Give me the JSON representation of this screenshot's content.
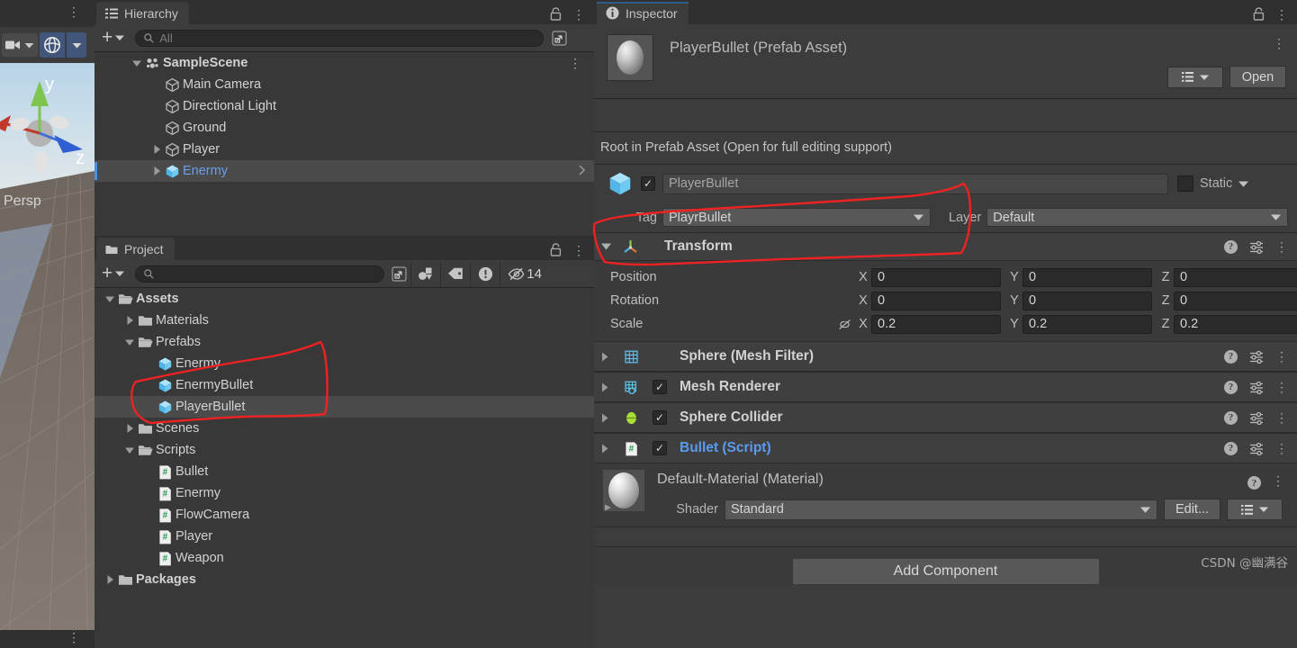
{
  "scene_view": {
    "camera_dropdown_icon": "camera-icon",
    "gizmo_icon": "scene-gizmo-icon",
    "axis_y": "y",
    "axis_z": "z",
    "projection_label": "Persp"
  },
  "hierarchy": {
    "tab_label": "Hierarchy",
    "tab_icon": "hierarchy-icon",
    "lock_icon": "lock-icon",
    "menu_icon": "kebab-menu-icon",
    "add_label": "+",
    "search_placeholder": "All",
    "search_icon": "search-icon",
    "expand_icon": "open-in-new-icon",
    "items": [
      {
        "label": "SampleScene",
        "icon": "scene-icon",
        "indent": 0,
        "arrow": "down",
        "bold": true,
        "selected": false,
        "blue": false,
        "menu": true
      },
      {
        "label": "Main Camera",
        "icon": "gameobject-icon",
        "indent": 1,
        "arrow": "none",
        "bold": false,
        "selected": false,
        "blue": false,
        "menu": false
      },
      {
        "label": "Directional Light",
        "icon": "gameobject-icon",
        "indent": 1,
        "arrow": "none",
        "bold": false,
        "selected": false,
        "blue": false,
        "menu": false
      },
      {
        "label": "Ground",
        "icon": "gameobject-icon",
        "indent": 1,
        "arrow": "none",
        "bold": false,
        "selected": false,
        "blue": false,
        "menu": false
      },
      {
        "label": "Player",
        "icon": "gameobject-icon",
        "indent": 1,
        "arrow": "right",
        "bold": false,
        "selected": false,
        "blue": false,
        "menu": false
      },
      {
        "label": "Enermy",
        "icon": "prefab-icon",
        "indent": 1,
        "arrow": "right",
        "bold": false,
        "selected": true,
        "blue": true,
        "menu": false
      }
    ]
  },
  "project": {
    "tab_label": "Project",
    "tab_icon": "folder-icon",
    "lock_icon": "lock-icon",
    "menu_icon": "kebab-menu-icon",
    "add_label": "+",
    "search_placeholder": "",
    "search_icon": "search-icon",
    "toolbar_icons": [
      "open-in-new-icon",
      "asset-filter-icon",
      "label-filter-icon",
      "warning-filter-icon"
    ],
    "hidden_count": "14",
    "hidden_icon": "eye-off-icon",
    "items": [
      {
        "label": "Assets",
        "icon": "folder-open-icon",
        "indent": 0,
        "arrow": "down",
        "bold": true,
        "selected": false
      },
      {
        "label": "Materials",
        "icon": "folder-icon",
        "indent": 1,
        "arrow": "right",
        "bold": false,
        "selected": false
      },
      {
        "label": "Prefabs",
        "icon": "folder-open-icon",
        "indent": 1,
        "arrow": "down",
        "bold": false,
        "selected": false
      },
      {
        "label": "Enermy",
        "icon": "prefab-icon",
        "indent": 2,
        "arrow": "none",
        "bold": false,
        "selected": false
      },
      {
        "label": "EnermyBullet",
        "icon": "prefab-icon",
        "indent": 2,
        "arrow": "none",
        "bold": false,
        "selected": false
      },
      {
        "label": "PlayerBullet",
        "icon": "prefab-icon",
        "indent": 2,
        "arrow": "none",
        "bold": false,
        "selected": true
      },
      {
        "label": "Scenes",
        "icon": "folder-icon",
        "indent": 1,
        "arrow": "right",
        "bold": false,
        "selected": false
      },
      {
        "label": "Scripts",
        "icon": "folder-open-icon",
        "indent": 1,
        "arrow": "down",
        "bold": false,
        "selected": false
      },
      {
        "label": "Bullet",
        "icon": "script-icon",
        "indent": 2,
        "arrow": "none",
        "bold": false,
        "selected": false
      },
      {
        "label": "Enermy",
        "icon": "script-icon",
        "indent": 2,
        "arrow": "none",
        "bold": false,
        "selected": false
      },
      {
        "label": "FlowCamera",
        "icon": "script-icon",
        "indent": 2,
        "arrow": "none",
        "bold": false,
        "selected": false
      },
      {
        "label": "Player",
        "icon": "script-icon",
        "indent": 2,
        "arrow": "none",
        "bold": false,
        "selected": false
      },
      {
        "label": "Weapon",
        "icon": "script-icon",
        "indent": 2,
        "arrow": "none",
        "bold": false,
        "selected": false
      },
      {
        "label": "Packages",
        "icon": "folder-icon",
        "indent": 0,
        "arrow": "right",
        "bold": true,
        "selected": false
      }
    ]
  },
  "inspector": {
    "tab_label": "Inspector",
    "tab_icon": "info-icon",
    "lock_icon": "lock-icon",
    "menu_icon": "kebab-menu-icon",
    "asset_title": "PlayerBullet (Prefab Asset)",
    "preview_icon": "sphere-preview",
    "header_menu_icon": "kebab-menu-icon",
    "preset_icon": "preset-list-icon",
    "open_button": "Open",
    "banner_text": "Root in Prefab Asset (Open for full editing support)",
    "object": {
      "icon": "prefab-icon",
      "enabled": true,
      "name": "PlayerBullet",
      "static_label": "Static",
      "static_checked": false,
      "tag_label": "Tag",
      "tag_value": "PlayrBullet",
      "layer_label": "Layer",
      "layer_value": "Default"
    },
    "transform": {
      "title": "Transform",
      "icon": "transform-icon",
      "help_icon": "help-icon",
      "settings_icon": "preset-settings-icon",
      "menu_icon": "kebab-menu-icon",
      "rows": [
        {
          "name": "Position",
          "x": "0",
          "y": "0",
          "z": "0",
          "lock_icon": ""
        },
        {
          "name": "Rotation",
          "x": "0",
          "y": "0",
          "z": "0",
          "lock_icon": ""
        },
        {
          "name": "Scale",
          "x": "0.2",
          "y": "0.2",
          "z": "0.2",
          "lock_icon": "link-broken-icon"
        }
      ],
      "axis_labels": [
        "X",
        "Y",
        "Z"
      ]
    },
    "components": [
      {
        "title": "Sphere (Mesh Filter)",
        "icon": "mesh-filter-icon",
        "has_checkbox": false,
        "checked": false,
        "script": false
      },
      {
        "title": "Mesh Renderer",
        "icon": "mesh-renderer-icon",
        "has_checkbox": true,
        "checked": true,
        "script": false
      },
      {
        "title": "Sphere Collider",
        "icon": "collider-icon",
        "has_checkbox": true,
        "checked": true,
        "script": false
      },
      {
        "title": "Bullet (Script)",
        "icon": "script-icon",
        "has_checkbox": true,
        "checked": true,
        "script": true
      }
    ],
    "material": {
      "title": "Default-Material (Material)",
      "icon": "material-sphere-icon",
      "help_icon": "help-icon",
      "menu_icon": "kebab-menu-icon",
      "shader_label": "Shader",
      "shader_value": "Standard",
      "edit_button": "Edit...",
      "preset_icon": "preset-list-icon"
    },
    "add_component_button": "Add Component"
  },
  "watermark": "CSDN @幽满谷",
  "colors": {
    "panel_bg": "#383838",
    "toolbar_bg": "#3c3c3c",
    "tabstrip_bg": "#303030",
    "selection": "#4b4b4b",
    "accent_blue": "#6d9eeb",
    "prefab_blue": "#7bc8f5",
    "annotation_red": "#ee2222",
    "active_tab_border": "#2c5d87"
  }
}
